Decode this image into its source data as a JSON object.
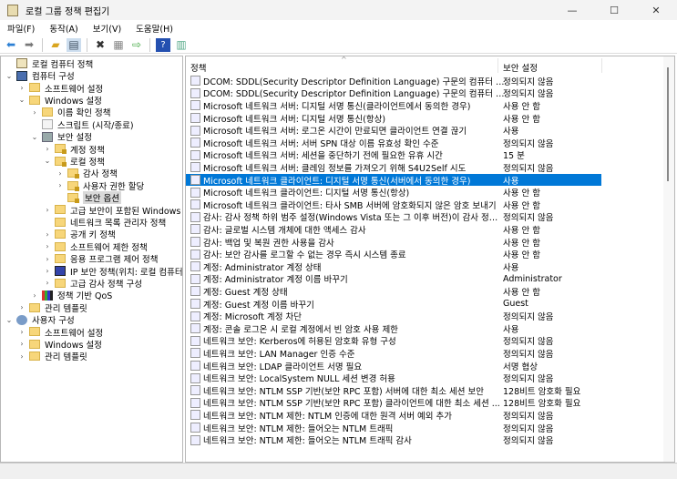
{
  "window": {
    "title": "로컬 그룹 정책 편집기",
    "minimize": "—",
    "maximize": "☐",
    "close": "✕"
  },
  "menu": [
    "파일(F)",
    "동작(A)",
    "보기(V)",
    "도움말(H)"
  ],
  "toolbar": [
    "back-icon",
    "forward-icon",
    "up-folder-icon",
    "show-hide-tree-icon",
    "delete-icon",
    "properties-icon",
    "export-icon",
    "help-icon",
    "show-action-pane-icon"
  ],
  "tree": [
    {
      "label": "로컬 컴퓨터 정책",
      "level": 0,
      "arrow": "",
      "icon": "policy"
    },
    {
      "label": "컴퓨터 구성",
      "level": 0,
      "arrow": "⌄",
      "icon": "computer"
    },
    {
      "label": "소프트웨어 설정",
      "level": 1,
      "arrow": "›",
      "icon": "folder"
    },
    {
      "label": "Windows 설정",
      "level": 1,
      "arrow": "⌄",
      "icon": "folder"
    },
    {
      "label": "이름 확인 정책",
      "level": 2,
      "arrow": "›",
      "icon": "folder"
    },
    {
      "label": "스크립트 (시작/종료)",
      "level": 2,
      "arrow": "",
      "icon": "script"
    },
    {
      "label": "보안 설정",
      "level": 2,
      "arrow": "⌄",
      "icon": "security"
    },
    {
      "label": "계정 정책",
      "level": 3,
      "arrow": "›",
      "icon": "lockfolder"
    },
    {
      "label": "로컬 정책",
      "level": 3,
      "arrow": "⌄",
      "icon": "lockfolder"
    },
    {
      "label": "감사 정책",
      "level": 4,
      "arrow": "›",
      "icon": "lockfolder"
    },
    {
      "label": "사용자 권한 할당",
      "level": 4,
      "arrow": "›",
      "icon": "lockfolder"
    },
    {
      "label": "보안 옵션",
      "level": 4,
      "arrow": "",
      "icon": "lockfolder",
      "selected": true
    },
    {
      "label": "고급 보안이 포함된 Windows Defender 방화벽",
      "level": 3,
      "arrow": "›",
      "icon": "folder"
    },
    {
      "label": "네트워크 목록 관리자 정책",
      "level": 3,
      "arrow": "",
      "icon": "folder"
    },
    {
      "label": "공개 키 정책",
      "level": 3,
      "arrow": "›",
      "icon": "folder"
    },
    {
      "label": "소프트웨어 제한 정책",
      "level": 3,
      "arrow": "›",
      "icon": "folder"
    },
    {
      "label": "응용 프로그램 제어 정책",
      "level": 3,
      "arrow": "›",
      "icon": "folder"
    },
    {
      "label": "IP 보안 정책(위치: 로컬 컴퓨터)",
      "level": 3,
      "arrow": "›",
      "icon": "ipsec"
    },
    {
      "label": "고급 감사 정책 구성",
      "level": 3,
      "arrow": "›",
      "icon": "folder"
    },
    {
      "label": "정책 기반 QoS",
      "level": 2,
      "arrow": "›",
      "icon": "chart"
    },
    {
      "label": "관리 템플릿",
      "level": 1,
      "arrow": "›",
      "icon": "folder"
    },
    {
      "label": "사용자 구성",
      "level": 0,
      "arrow": "⌄",
      "icon": "user"
    },
    {
      "label": "소프트웨어 설정",
      "level": 1,
      "arrow": "›",
      "icon": "folder"
    },
    {
      "label": "Windows 설정",
      "level": 1,
      "arrow": "›",
      "icon": "folder"
    },
    {
      "label": "관리 템플릿",
      "level": 1,
      "arrow": "›",
      "icon": "folder"
    }
  ],
  "list": {
    "columns": [
      "정책",
      "보안 설정"
    ],
    "sort_indicator": "^",
    "rows": [
      {
        "policy": "DCOM: SDDL(Security Descriptor Definition Language) 구문의 컴퓨터 실행 제한",
        "setting": "정의되지 않음"
      },
      {
        "policy": "DCOM: SDDL(Security Descriptor Definition Language) 구문의 컴퓨터 액세스 ...",
        "setting": "정의되지 않음"
      },
      {
        "policy": "Microsoft 네트워크 서버: 디지털 서명 통신(클라이언트에서 동의한 경우)",
        "setting": "사용 안 함"
      },
      {
        "policy": "Microsoft 네트워크 서버: 디지털 서명 통신(항상)",
        "setting": "사용 안 함"
      },
      {
        "policy": "Microsoft 네트워크 서버: 로그온 시간이 만료되면 클라이언트 연결 끊기",
        "setting": "사용"
      },
      {
        "policy": "Microsoft 네트워크 서버: 서버 SPN 대상 이름 유효성 확인 수준",
        "setting": "정의되지 않음"
      },
      {
        "policy": "Microsoft 네트워크 서버: 세션을 중단하기 전에 필요한 유휴 시간",
        "setting": "15 분"
      },
      {
        "policy": "Microsoft 네트워크 서버: 클레임 정보를 가져오기 위해 S4U2Self 시도",
        "setting": "정의되지 않음"
      },
      {
        "policy": "Microsoft 네트워크 클라이언트: 디지털 서명 통신(서버에서 동의한 경우)",
        "setting": "사용",
        "selected": true
      },
      {
        "policy": "Microsoft 네트워크 클라이언트: 디지털 서명 통신(항상)",
        "setting": "사용 안 함"
      },
      {
        "policy": "Microsoft 네트워크 클라이언트: 타사 SMB 서버에 암호화되지 않은 암호 보내기",
        "setting": "사용 안 함"
      },
      {
        "policy": "감사: 감사 정책 하위 범주 설정(Windows Vista 또는 그 이후 버전)이 감사 정책 ...",
        "setting": "정의되지 않음"
      },
      {
        "policy": "감사: 글로벌 시스템 개체에 대한 액세스 감사",
        "setting": "사용 안 함"
      },
      {
        "policy": "감사: 백업 및 복원 권한 사용을 감사",
        "setting": "사용 안 함"
      },
      {
        "policy": "감사: 보안 감사를 로그할 수 없는 경우 즉시 시스템 종료",
        "setting": "사용 안 함"
      },
      {
        "policy": "계정: Administrator 계정 상태",
        "setting": "사용"
      },
      {
        "policy": "계정: Administrator 계정 이름 바꾸기",
        "setting": "Administrator"
      },
      {
        "policy": "계정: Guest 계정 상태",
        "setting": "사용 안 함"
      },
      {
        "policy": "계정: Guest 계정 이름 바꾸기",
        "setting": "Guest"
      },
      {
        "policy": "계정: Microsoft 계정 차단",
        "setting": "정의되지 않음"
      },
      {
        "policy": "계정: 콘솔 로그온 시 로컬 계정에서 빈 암호 사용 제한",
        "setting": "사용"
      },
      {
        "policy": "네트워크 보안: Kerberos에 허용된 암호화 유형 구성",
        "setting": "정의되지 않음"
      },
      {
        "policy": "네트워크 보안: LAN Manager 인증 수준",
        "setting": "정의되지 않음"
      },
      {
        "policy": "네트워크 보안: LDAP 클라이언트 서명 필요",
        "setting": "서명 협상"
      },
      {
        "policy": "네트워크 보안: LocalSystem NULL 세션 변경 허용",
        "setting": "정의되지 않음"
      },
      {
        "policy": "네트워크 보안: NTLM SSP 기반(보안 RPC 포함) 서버에 대한 최소 세션 보안",
        "setting": "128비트 암호화 필요"
      },
      {
        "policy": "네트워크 보안: NTLM SSP 기반(보안 RPC 포함) 클라이언트에 대한 최소 세션 ...",
        "setting": "128비트 암호화 필요"
      },
      {
        "policy": "네트워크 보안: NTLM 제한: NTLM 인증에 대한 원격 서버 예외 추가",
        "setting": "정의되지 않음"
      },
      {
        "policy": "네트워크 보안: NTLM 제한: 들어오는 NTLM 트래픽",
        "setting": "정의되지 않음"
      },
      {
        "policy": "네트워크 보안: NTLM 제한: 들어오는 NTLM 트래픽 감사",
        "setting": "정의되지 않음"
      }
    ]
  }
}
